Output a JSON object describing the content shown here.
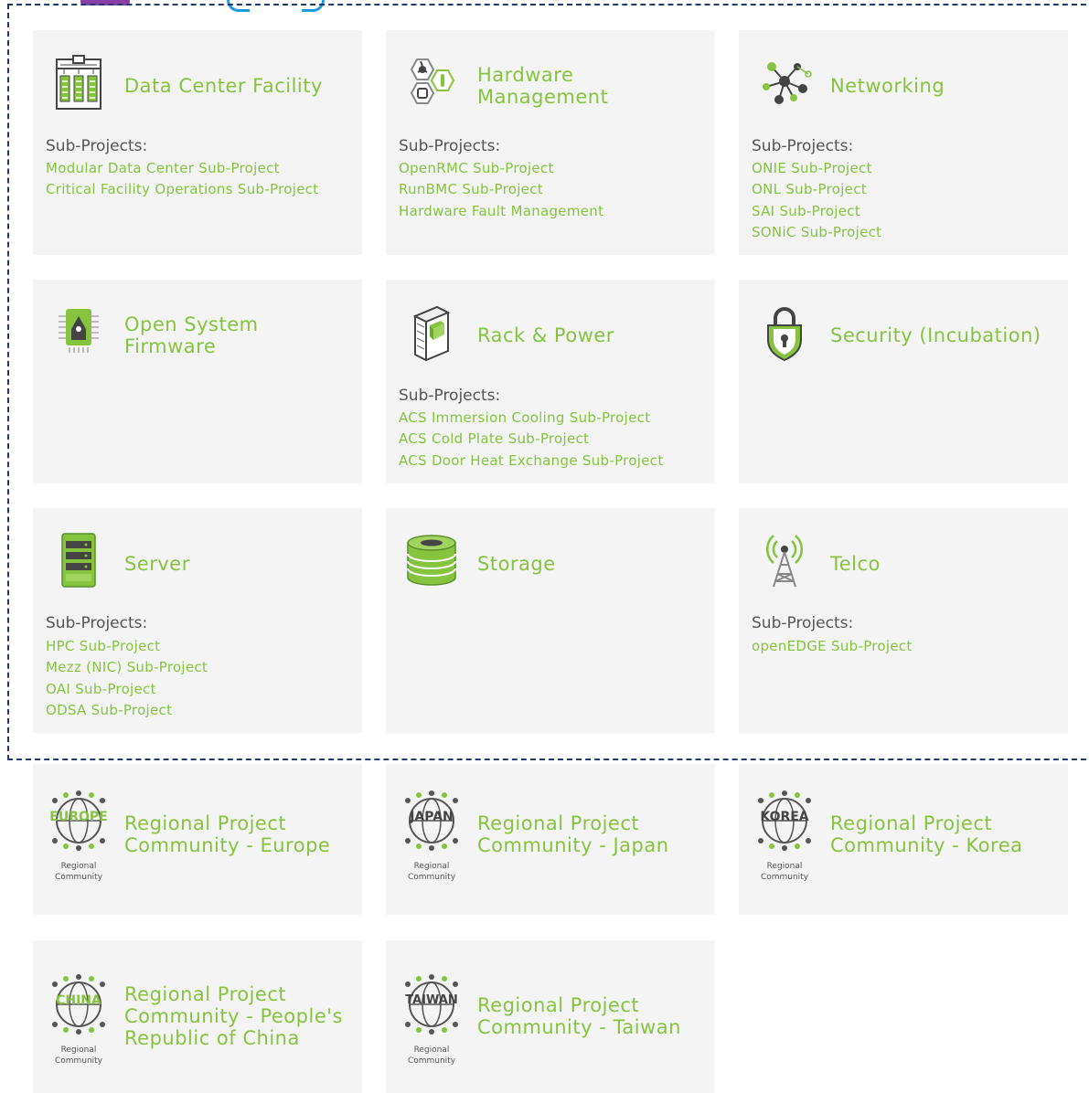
{
  "colors": {
    "accent": "#86c440",
    "card_bg": "#f4f4f4",
    "text": "#555555",
    "frame": "#1f3a6b"
  },
  "sub_projects_label": "Sub-Projects:",
  "cards": [
    {
      "title": "Data Center Facility",
      "icon": "data-center-icon",
      "links": [
        "Modular Data Center Sub-Project",
        "Critical Facility Operations Sub-Project"
      ]
    },
    {
      "title": "Hardware Management",
      "icon": "hardware-management-icon",
      "links": [
        "OpenRMC Sub-Project",
        "RunBMC Sub-Project",
        "Hardware Fault Management"
      ]
    },
    {
      "title": "Networking",
      "icon": "networking-icon",
      "links": [
        "ONIE Sub-Project",
        "ONL Sub-Project",
        "SAI Sub-Project",
        "SONiC Sub-Project"
      ]
    },
    {
      "title": "Open System Firmware",
      "icon": "firmware-chip-icon",
      "links": []
    },
    {
      "title": "Rack & Power",
      "icon": "rack-icon",
      "links": [
        "ACS Immersion Cooling Sub-Project",
        "ACS Cold Plate Sub-Project",
        "ACS Door Heat Exchange Sub-Project"
      ]
    },
    {
      "title": "Security (Incubation)",
      "icon": "security-lock-icon",
      "links": []
    },
    {
      "title": "Server",
      "icon": "server-icon",
      "links": [
        "HPC Sub-Project",
        "Mezz (NIC) Sub-Project",
        "OAI Sub-Project",
        "ODSA Sub-Project"
      ]
    },
    {
      "title": "Storage",
      "icon": "storage-icon",
      "links": []
    },
    {
      "title": "Telco",
      "icon": "telco-tower-icon",
      "links": [
        "openEDGE Sub-Project"
      ]
    }
  ],
  "regional": [
    {
      "title": "Regional Project Community - Europe",
      "badge": "EUROPE"
    },
    {
      "title": "Regional Project Community - Japan",
      "badge": "JAPAN"
    },
    {
      "title": "Regional Project Community - Korea",
      "badge": "KOREA"
    },
    {
      "title": "Regional Project Community - People's Republic of China",
      "badge": "CHINA"
    },
    {
      "title": "Regional Project Community - Taiwan",
      "badge": "TAIWAN"
    }
  ],
  "regional_badge_caption": "Regional Community"
}
